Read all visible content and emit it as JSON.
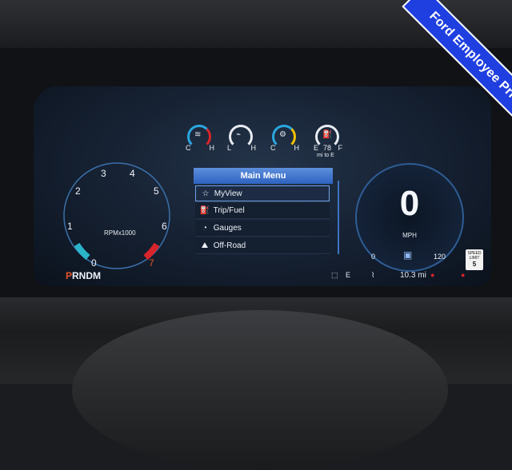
{
  "banner": {
    "text": "Ford Employee Pricing"
  },
  "gauges": {
    "coolant": {
      "low": "C",
      "high": "H",
      "icon": "coolant-temp-icon"
    },
    "oil": {
      "low": "L",
      "high": "H",
      "icon": "oil-pressure-icon"
    },
    "trans": {
      "low": "C",
      "high": "H",
      "icon": "transmission-temp-icon"
    },
    "fuel": {
      "low": "E",
      "high": "F",
      "range_value": "78",
      "range_unit": "mi to E",
      "icon": "fuel-pump-icon"
    }
  },
  "tachometer": {
    "numbers": [
      "0",
      "1",
      "2",
      "3",
      "4",
      "5",
      "6",
      "7"
    ],
    "label": "RPMx1000"
  },
  "speedometer": {
    "value": "0",
    "unit": "MPH",
    "min": "0",
    "max": "120"
  },
  "menu": {
    "title": "Main Menu",
    "items": [
      {
        "label": "MyView",
        "icon": "star-icon",
        "selected": true
      },
      {
        "label": "Trip/Fuel",
        "icon": "fuel-pump-icon",
        "selected": false
      },
      {
        "label": "Gauges",
        "icon": "gauge-icon",
        "selected": false
      },
      {
        "label": "Off-Road",
        "icon": "off-road-icon",
        "selected": false
      }
    ]
  },
  "status_bar": {
    "gear_selected": "P",
    "gear_rest": "RNDM",
    "compass": "E",
    "trip": "10.3 mi"
  },
  "speed_limit": {
    "top": "SPEED",
    "mid": "LIMIT",
    "value": "5"
  },
  "colors": {
    "accent": "#2e63c0",
    "banner": "#1f3fe0",
    "gear_active": "#e8542a",
    "redline": "#d8242a",
    "coolant_blue": "#2aa7e0"
  }
}
